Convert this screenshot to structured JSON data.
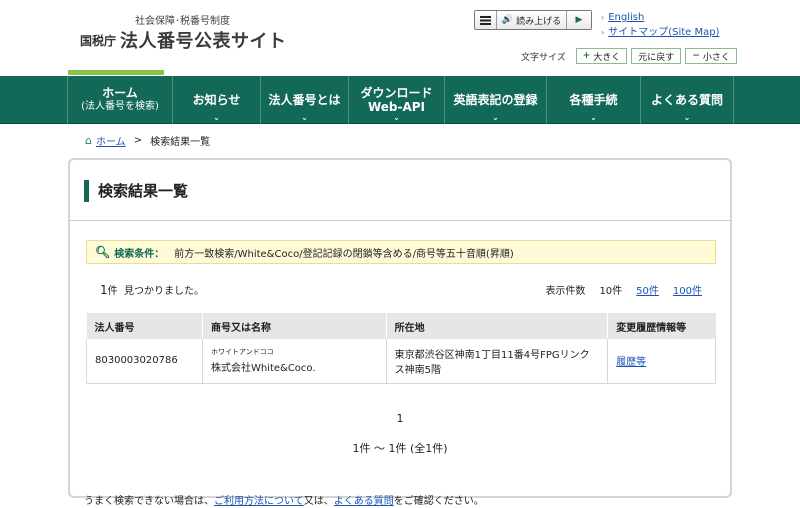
{
  "header": {
    "logo_sub": "社会保障･税番号制度",
    "logo_agency": "国税庁",
    "logo_title": "法人番号公表サイト",
    "read_aloud": "読み上げる",
    "links": [
      "English",
      "サイトマップ(Site Map)"
    ],
    "font_size_label": "文字サイズ",
    "font_larger": "大きく",
    "font_reset": "元に戻す",
    "font_smaller": "小さく"
  },
  "nav": {
    "items": [
      {
        "line1": "ホーム",
        "line2": "(法人番号を検索)"
      },
      {
        "line1": "お知らせ",
        "line2": ""
      },
      {
        "line1": "法人番号とは",
        "line2": ""
      },
      {
        "line1": "ダウンロード",
        "line2": "Web-API"
      },
      {
        "line1": "英語表記の登録",
        "line2": ""
      },
      {
        "line1": "各種手続",
        "line2": ""
      },
      {
        "line1": "よくある質問",
        "line2": ""
      }
    ]
  },
  "breadcrumb": {
    "home": "ホーム",
    "separator": ">",
    "current": "検索結果一覧"
  },
  "main": {
    "title": "検索結果一覧",
    "condition_label": "検索条件：",
    "condition_text": "前方一致検索/White&Coco/登記記録の閉鎖等含める/商号等五十音順(昇順)",
    "found_count": "1",
    "found_unit": "件",
    "found_text": "見つかりました。",
    "per_page_label": "表示件数",
    "per_page_current": "10件",
    "per_page_options": [
      "50件",
      "100件"
    ],
    "table": {
      "headers": [
        "法人番号",
        "商号又は名称",
        "所在地",
        "変更履歴情報等"
      ],
      "rows": [
        {
          "number": "8030003020786",
          "furigana": "ホワイトアンドココ",
          "name": "株式会社White&Coco.",
          "address": "東京都渋谷区神南1丁目11番4号FPGリンクス神南5階",
          "history": "履歴等"
        }
      ]
    },
    "pager_current": "1",
    "range_text": "1件 ～ 1件 (全1件)"
  },
  "footer_note": {
    "prefix": "うまく検索できない場合は、",
    "link1": "ご利用方法について",
    "middle": "又は、",
    "link2": "よくある質問",
    "suffix": "をご確認ください。"
  },
  "colors": {
    "nav_bg": "#136958",
    "accent_green": "#8bc34a",
    "link_blue": "#1b55b3",
    "condition_bg": "#fefbd6"
  }
}
